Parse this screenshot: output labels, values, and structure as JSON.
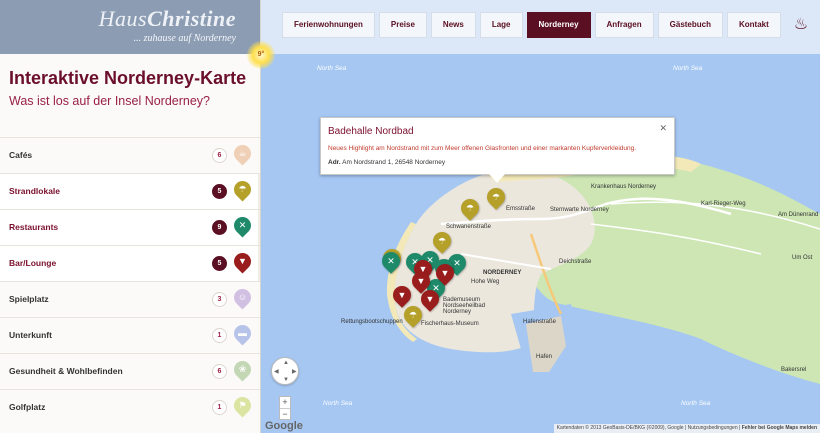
{
  "brand": {
    "name_light": "Haus",
    "name_bold": "Christine",
    "tagline": "... zuhause auf Norderney"
  },
  "intro": {
    "title": "Interaktive Norderney-Karte",
    "subtitle": "Was ist los auf der Insel Norderney?"
  },
  "categories": [
    {
      "label": "Cafés",
      "count": "6",
      "active": false,
      "color": "#e8b38a",
      "icon": "coffee-icon"
    },
    {
      "label": "Strandlokale",
      "count": "5",
      "active": true,
      "color": "#b5a02a",
      "icon": "beach-umbrella-icon"
    },
    {
      "label": "Restaurants",
      "count": "9",
      "active": true,
      "color": "#1f8a6a",
      "icon": "cutlery-icon"
    },
    {
      "label": "Bar/Lounge",
      "count": "5",
      "active": true,
      "color": "#9a1d1d",
      "icon": "cocktail-icon"
    },
    {
      "label": "Spielplatz",
      "count": "3",
      "active": false,
      "color": "#b89ad6",
      "icon": "playground-icon"
    },
    {
      "label": "Unterkunft",
      "count": "1",
      "active": false,
      "color": "#8aa0e0",
      "icon": "bed-icon"
    },
    {
      "label": "Gesundheit & Wohlbefinden",
      "count": "6",
      "active": false,
      "color": "#9ec08a",
      "icon": "wellness-icon"
    },
    {
      "label": "Golfplatz",
      "count": "1",
      "active": false,
      "color": "#c8d66a",
      "icon": "golf-icon"
    }
  ],
  "nav": [
    {
      "label": "Ferienwohnungen",
      "active": false
    },
    {
      "label": "Preise",
      "active": false
    },
    {
      "label": "News",
      "active": false
    },
    {
      "label": "Lage",
      "active": false
    },
    {
      "label": "Norderney",
      "active": true
    },
    {
      "label": "Anfragen",
      "active": false
    },
    {
      "label": "Gästebuch",
      "active": false
    },
    {
      "label": "Kontakt",
      "active": false
    }
  ],
  "weather": {
    "temp": "9°"
  },
  "map": {
    "sea_labels": [
      "North Sea",
      "North Sea",
      "North Sea",
      "North Sea"
    ],
    "place_labels": [
      "Krankenhaus Norderney",
      "Sternwarte Norderney",
      "NORDERNEY",
      "Emsstraße",
      "Deichstraße",
      "Hafenstraße",
      "Fischerhaus-Museum",
      "Bademuseum Nordseeheilbad Norderney",
      "Rettungsbootschuppen",
      "Karl-Rieger-Weg",
      "Am Dünenrand",
      "Um Ost",
      "Bakersrel",
      "Hafen",
      "Schwanenstraße",
      "Hohe Weg"
    ],
    "info": {
      "title": "Badehalle Nordbad",
      "description": "Neues Highlight am Nordstrand mit zum Meer offenen Glasfronten und einer markanten Kupferverkleidung.",
      "address_label": "Adr.",
      "address": "Am Nordstrand 1, 26548 Norderney"
    },
    "zoom_in": "+",
    "zoom_out": "−",
    "google": "Google",
    "attribution": "Kartendaten © 2013 GeoBasis-DE/BKG (©2009), Google",
    "terms": "Nutzungsbedingungen",
    "report": "Fehler bei Google Maps melden"
  }
}
